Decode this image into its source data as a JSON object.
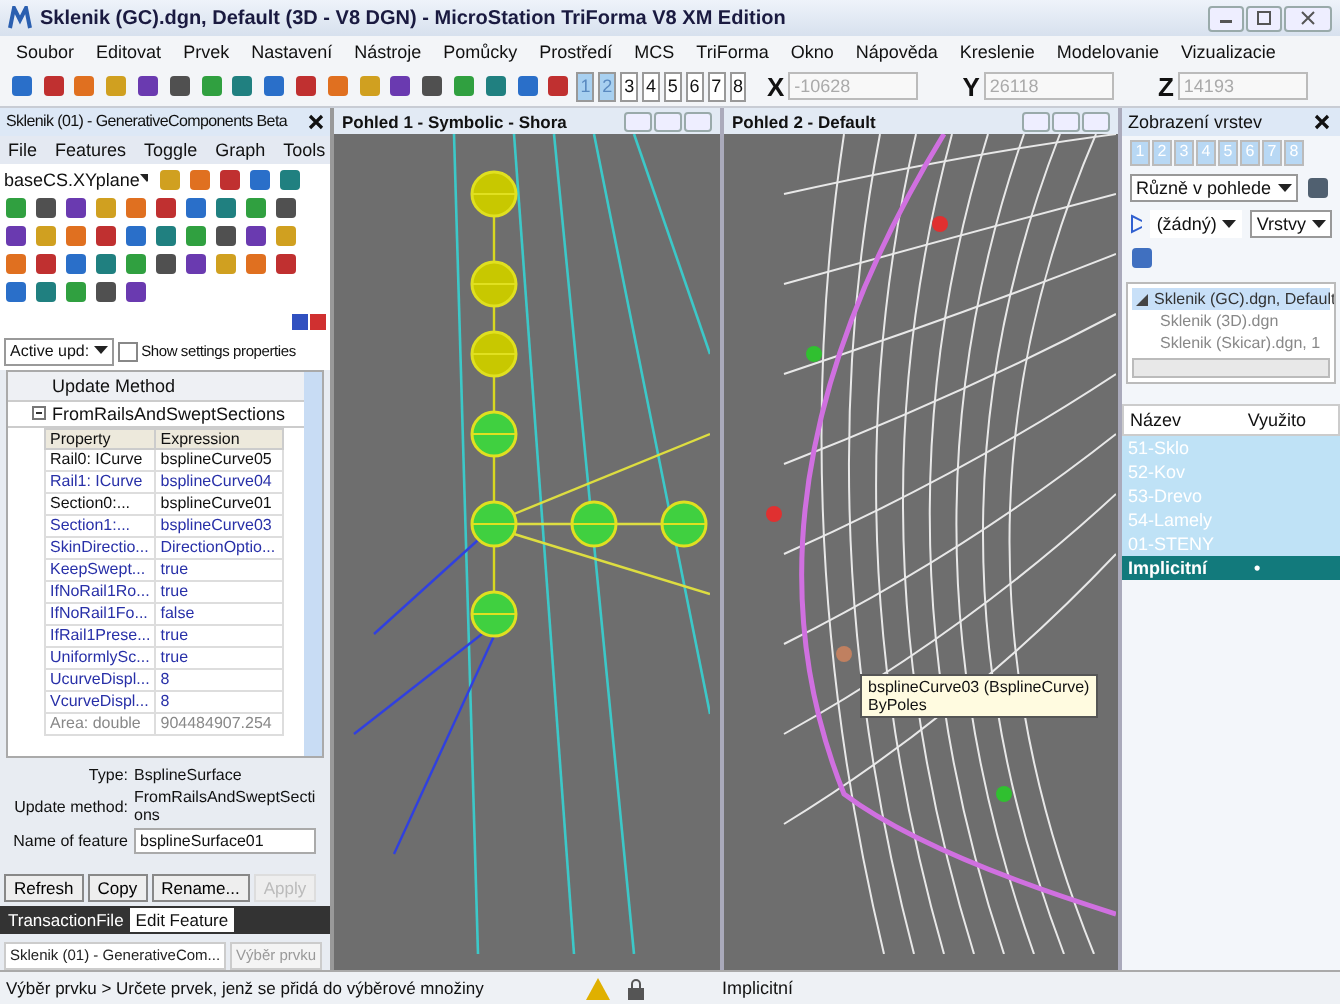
{
  "window": {
    "title": "Sklenik (GC).dgn, Default (3D - V8 DGN) - MicroStation TriForma V8 XM Edition"
  },
  "menu": [
    "Soubor",
    "Editovat",
    "Prvek",
    "Nastavení",
    "Nástroje",
    "Pomůcky",
    "Prostředí",
    "MCS",
    "TriForma",
    "Okno",
    "Nápověda",
    "Kreslenie",
    "Modelovanie",
    "Vizualizacie"
  ],
  "toolbar": {
    "views": [
      {
        "label": "1",
        "selected": true
      },
      {
        "label": "2",
        "selected": true
      },
      {
        "label": "3",
        "selected": false
      },
      {
        "label": "4",
        "selected": false
      },
      {
        "label": "5",
        "selected": false
      },
      {
        "label": "6",
        "selected": false
      },
      {
        "label": "7",
        "selected": false
      },
      {
        "label": "8",
        "selected": false
      }
    ],
    "coords": [
      {
        "label": "X",
        "value": "-10628",
        "disabled": true
      },
      {
        "label": "Y",
        "value": "26118",
        "disabled": true
      },
      {
        "label": "Z",
        "value": "14193",
        "disabled": true
      }
    ]
  },
  "gc_panel": {
    "title": "Sklenik (01) - GenerativeComponents Beta",
    "menu": [
      "File",
      "Features",
      "Toggle",
      "Graph",
      "Tools"
    ],
    "plane": "baseCS.XYplane",
    "update_select": "Active upd:",
    "show_settings": {
      "label": "Show settings properties",
      "checked": false
    },
    "grid": {
      "header": "Update Method",
      "method": "FromRailsAndSweptSections",
      "columns": [
        "Property",
        "Expression"
      ],
      "rows": [
        {
          "property": "Rail0: ICurve",
          "expression": "bsplineCurve05",
          "kind": "required"
        },
        {
          "property": "Rail1: ICurve",
          "expression": "bsplineCurve04",
          "kind": "optional"
        },
        {
          "property": "Section0:...",
          "expression": "bsplineCurve01",
          "kind": "required"
        },
        {
          "property": "Section1:...",
          "expression": "bsplineCurve03",
          "kind": "optional"
        },
        {
          "property": "SkinDirectio...",
          "expression": "DirectionOptio...",
          "kind": "optional"
        },
        {
          "property": "KeepSwept...",
          "expression": "true",
          "kind": "optional"
        },
        {
          "property": "IfNoRail1Ro...",
          "expression": "true",
          "kind": "optional"
        },
        {
          "property": "IfNoRail1Fo...",
          "expression": "false",
          "kind": "optional"
        },
        {
          "property": "IfRail1Prese...",
          "expression": "true",
          "kind": "optional"
        },
        {
          "property": "UniformlySc...",
          "expression": "true",
          "kind": "optional"
        },
        {
          "property": "UcurveDispl...",
          "expression": "8",
          "kind": "optional"
        },
        {
          "property": "VcurveDispl...",
          "expression": "8",
          "kind": "optional"
        },
        {
          "property": "Area: double",
          "expression": "904484907.254",
          "kind": "readonly"
        }
      ]
    },
    "info": [
      {
        "label": "Type:",
        "value": "BsplineSurface",
        "kind": "text"
      },
      {
        "label": "Update method:",
        "value": "FromRailsAndSweptSections",
        "kind": "text"
      },
      {
        "label": "Name of feature",
        "value": "bsplineSurface01",
        "kind": "field"
      }
    ],
    "buttons": [
      {
        "label": "Refresh",
        "disabled": false
      },
      {
        "label": "Copy",
        "disabled": false
      },
      {
        "label": "Rename...",
        "disabled": false
      },
      {
        "label": "Apply",
        "disabled": true
      }
    ],
    "tabs": [
      {
        "label": "TransactionFile",
        "selected": false
      },
      {
        "label": "Edit Feature",
        "selected": true
      }
    ],
    "bottom_tabs": [
      {
        "label": "Sklenik (01) - GenerativeCom...",
        "selected": true
      },
      {
        "label": "Výběr prvku",
        "selected": false
      }
    ]
  },
  "views": [
    {
      "title": "Pohled 1 - Symbolic - Shora",
      "kind": "graph"
    },
    {
      "title": "Pohled 2 - Default",
      "kind": "model"
    }
  ],
  "tooltip": {
    "title": "bsplineCurve03 (BsplineCurve)",
    "subtitle": "ByPoles"
  },
  "layers_panel": {
    "title": "Zobrazení vrstev",
    "views": [
      {
        "label": "1",
        "selected": true
      },
      {
        "label": "2",
        "selected": true
      },
      {
        "label": "3",
        "selected": true
      },
      {
        "label": "4",
        "selected": true
      },
      {
        "label": "5",
        "selected": true
      },
      {
        "label": "6",
        "selected": true
      },
      {
        "label": "7",
        "selected": true
      },
      {
        "label": "8",
        "selected": true
      }
    ],
    "mode_select": "Různě v pohlede",
    "filter_select": "(žádný)",
    "layers_select": "Vrstvy",
    "tree": [
      {
        "label": "Sklenik (GC).dgn, Default",
        "selected": true,
        "expanded": true,
        "children": [
          {
            "label": "Sklenik (3D).dgn",
            "selected": false
          },
          {
            "label": "Sklenik (Skicar).dgn, 1",
            "selected": false
          }
        ]
      }
    ],
    "columns": [
      "Název",
      "Využito"
    ],
    "layers": [
      {
        "name": "51-Sklo",
        "active": false
      },
      {
        "name": "52-Kov",
        "active": false
      },
      {
        "name": "53-Drevo",
        "active": false
      },
      {
        "name": "54-Lamely",
        "active": false
      },
      {
        "name": "01-STENY",
        "active": false
      },
      {
        "name": "Implicitní",
        "used": "•",
        "active": true
      }
    ]
  },
  "status_bar": {
    "prompt": "Výběr prvku > Určete prvek, jenž se přidá do výběrové množiny",
    "layer": "Implicitní"
  }
}
